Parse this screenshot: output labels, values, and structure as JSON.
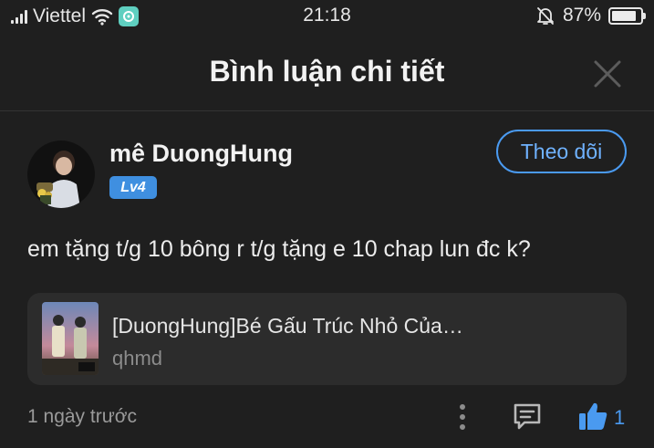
{
  "status_bar": {
    "carrier": "Viettel",
    "time": "21:18",
    "battery_percent": "87%",
    "battery_level": 0.87,
    "icons": [
      "signal-icon",
      "wifi-icon",
      "app-notification-icon",
      "mute-bell-icon",
      "battery-icon"
    ]
  },
  "header": {
    "title": "Bình luận chi tiết",
    "close_icon": "close-icon"
  },
  "comment": {
    "username": "mê DuongHung",
    "level": "Lv4",
    "follow_label": "Theo dõi",
    "text": "em tặng t/g 10 bông r t/g tặng e 10 chap lun đc k?",
    "timestamp": "1 ngày trước",
    "like_count": "1"
  },
  "linked_story": {
    "title": "[DuongHung]Bé Gấu Trúc Nhỏ Của…",
    "subtitle": "qhmd"
  },
  "actions": {
    "more_icon": "more-vertical-icon",
    "reply_icon": "comment-icon",
    "like_icon": "thumbs-up-icon"
  },
  "colors": {
    "background": "#1f1f1f",
    "accent": "#4a9af0",
    "level_badge": "#3f8fe0",
    "card_background": "#2c2c2c"
  }
}
